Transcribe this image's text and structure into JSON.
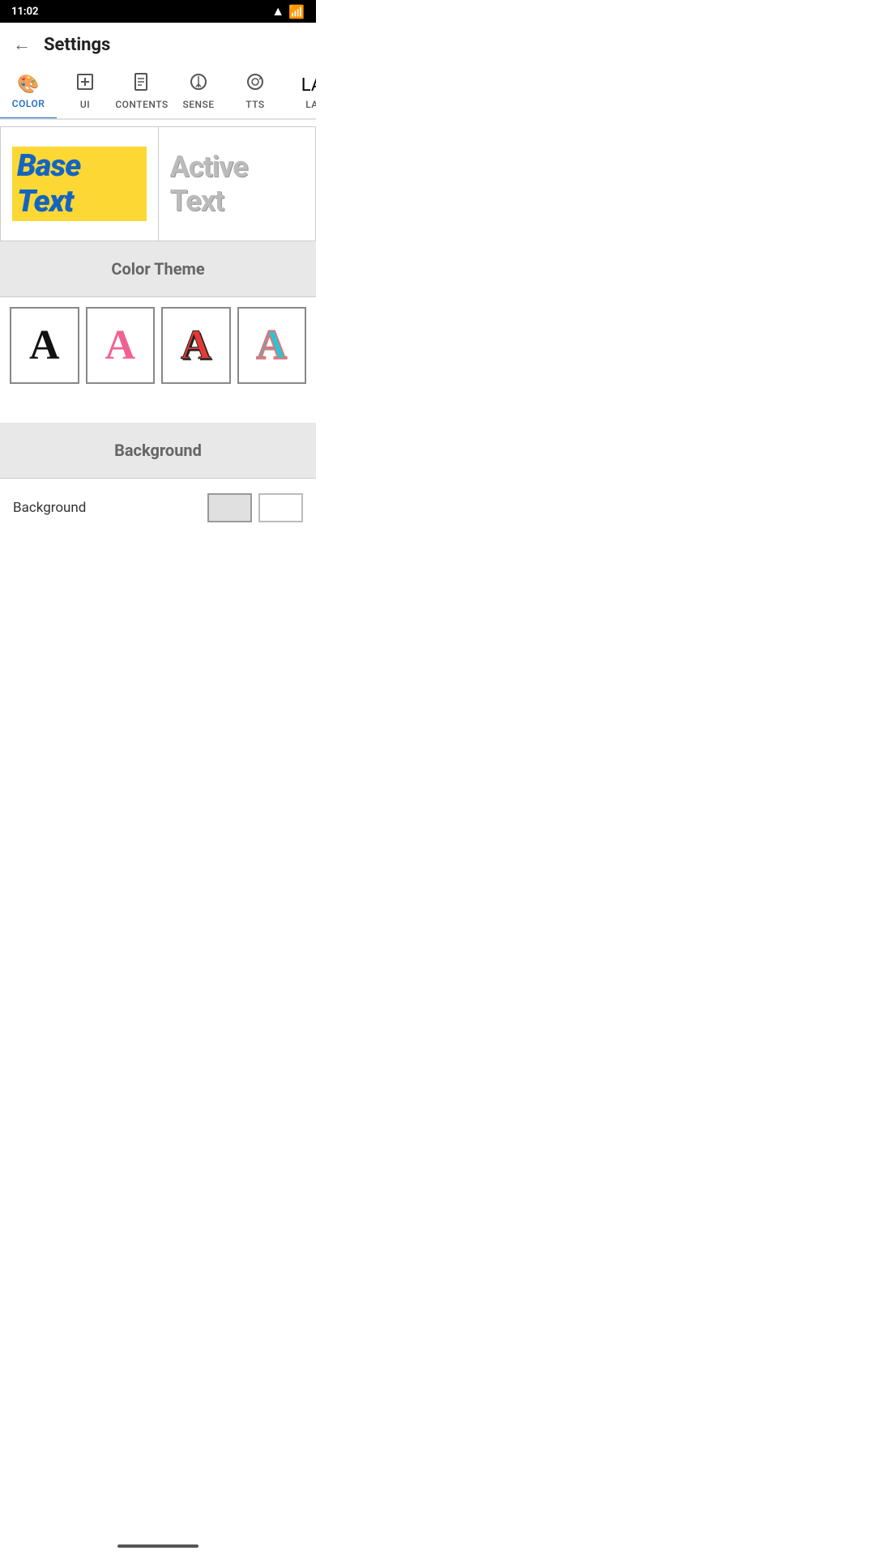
{
  "statusBar": {
    "time": "11:02",
    "icons": [
      "wifi",
      "signal"
    ]
  },
  "header": {
    "backLabel": "←",
    "title": "Settings"
  },
  "tabs": [
    {
      "id": "color",
      "label": "COLOR",
      "icon": "🎨",
      "active": true
    },
    {
      "id": "ui",
      "label": "UI",
      "icon": "⬇️",
      "active": false
    },
    {
      "id": "contents",
      "label": "CONTENTS",
      "icon": "📄",
      "active": false
    },
    {
      "id": "sense",
      "label": "SENSE",
      "icon": "⏬",
      "active": false
    },
    {
      "id": "tts",
      "label": "TTS",
      "icon": "📡",
      "active": false
    },
    {
      "id": "la",
      "label": "LA",
      "icon": "🔤",
      "active": false
    }
  ],
  "preview": {
    "baseText": "Base Text",
    "activeText": "Active Text"
  },
  "colorTheme": {
    "sectionTitle": "Color Theme",
    "options": [
      {
        "id": "black",
        "style": "black"
      },
      {
        "id": "pink",
        "style": "pink"
      },
      {
        "id": "red-shadow",
        "style": "red-shadow"
      },
      {
        "id": "teal-outline",
        "style": "teal-outline"
      }
    ]
  },
  "background": {
    "sectionTitle": "Background",
    "rowLabel": "Background",
    "swatches": [
      "gray",
      "white"
    ]
  }
}
